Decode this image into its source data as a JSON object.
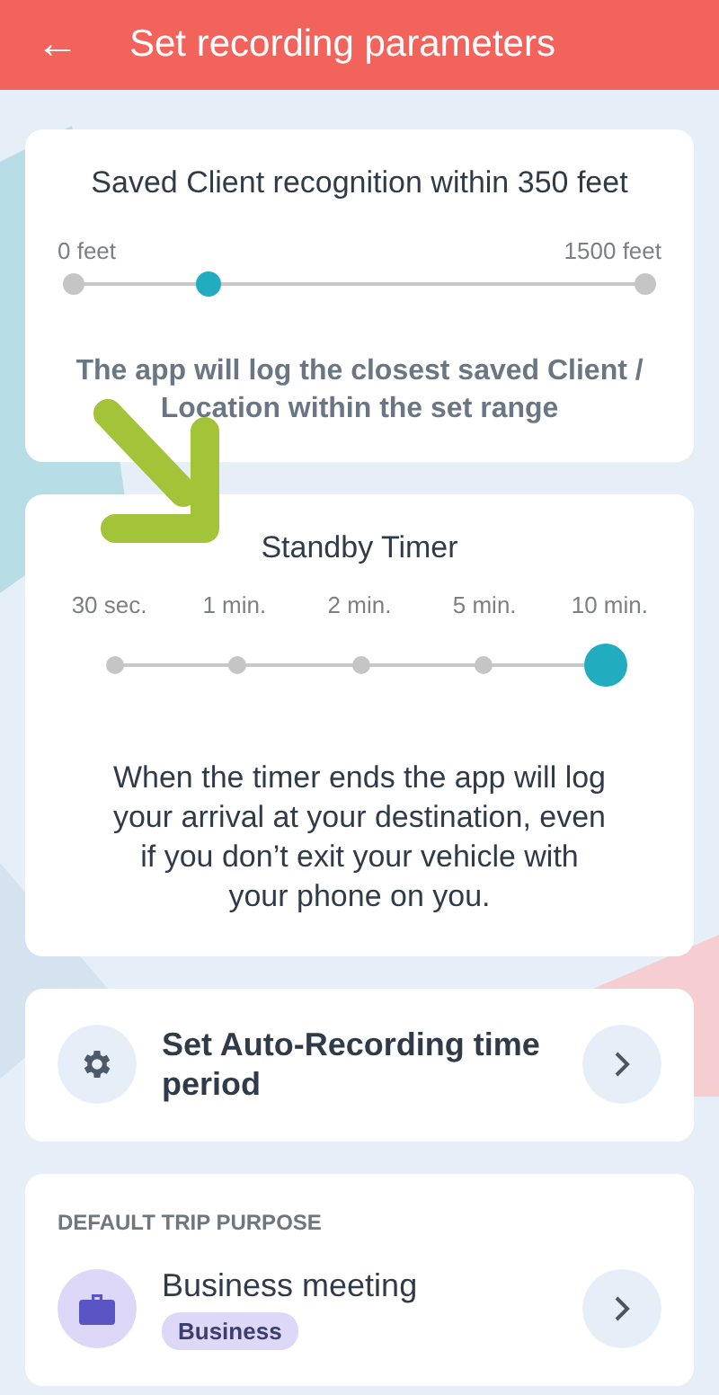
{
  "header": {
    "back_glyph": "←",
    "title": "Set recording parameters"
  },
  "recognition": {
    "title": "Saved Client recognition within 350 feet",
    "min_label": "0 feet",
    "max_label": "1500 feet",
    "level": 0.236,
    "note": "The app will log the closest saved Client / Location within the set range"
  },
  "standby": {
    "title": "Standby Timer",
    "stops": [
      {
        "label": "30 sec.",
        "selected": false
      },
      {
        "label": "1 min.",
        "selected": false
      },
      {
        "label": "2 min.",
        "selected": false
      },
      {
        "label": "5 min.",
        "selected": false
      },
      {
        "label": "10 min.",
        "selected": true
      }
    ],
    "note": "When the timer ends the app will log your arrival at your destination, even if you don’t exit your vehicle with your phone on you."
  },
  "auto_recording": {
    "label": "Set Auto-Recording time period"
  },
  "trip_purpose": {
    "heading": "DEFAULT TRIP PURPOSE",
    "name": "Business meeting",
    "tag": "Business"
  }
}
